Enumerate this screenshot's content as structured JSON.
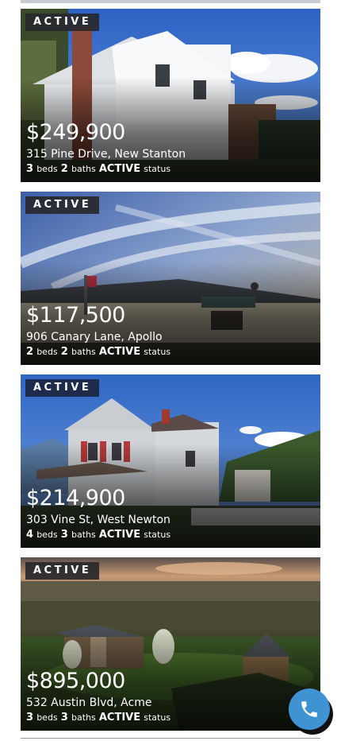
{
  "listings": [
    {
      "status_badge": "ACTIVE",
      "price": "$249,900",
      "address": "315 Pine Drive, New Stanton",
      "beds": "3",
      "beds_label": "beds",
      "baths": "2",
      "baths_label": "baths",
      "status": "ACTIVE",
      "status_label": "status"
    },
    {
      "status_badge": "ACTIVE",
      "price": "$117,500",
      "address": "906 Canary Lane, Apollo",
      "beds": "2",
      "beds_label": "beds",
      "baths": "2",
      "baths_label": "baths",
      "status": "ACTIVE",
      "status_label": "status"
    },
    {
      "status_badge": "ACTIVE",
      "price": "$214,900",
      "address": "303 Vine St, West Newton",
      "beds": "4",
      "beds_label": "beds",
      "baths": "3",
      "baths_label": "baths",
      "status": "ACTIVE",
      "status_label": "status"
    },
    {
      "status_badge": "ACTIVE",
      "price": "$895,000",
      "address": "532 Austin Blvd, Acme",
      "beds": "3",
      "beds_label": "beds",
      "baths": "3",
      "baths_label": "baths",
      "status": "ACTIVE",
      "status_label": "status"
    }
  ],
  "call_button": {
    "icon": "phone-icon",
    "color": "#3f93d3"
  },
  "colors": {
    "badge_dark": "#28282d",
    "badge_blue": "#1c2846"
  }
}
